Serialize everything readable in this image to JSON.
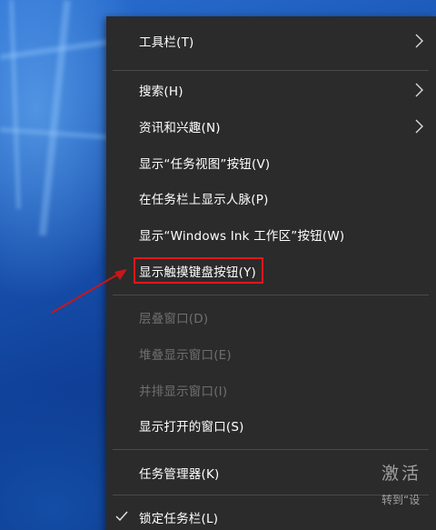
{
  "menu": {
    "items": [
      {
        "label": "工具栏(T)",
        "submenu": true
      },
      {
        "label": "搜索(H)",
        "submenu": true
      },
      {
        "label": "资讯和兴趣(N)",
        "submenu": true
      },
      {
        "label": "显示“任务视图”按钮(V)"
      },
      {
        "label": "在任务栏上显示人脉(P)"
      },
      {
        "label": "显示“Windows Ink 工作区”按钮(W)"
      },
      {
        "label": "显示触摸键盘按钮(Y)",
        "highlighted": true
      },
      {
        "label": "层叠窗口(D)",
        "disabled": true
      },
      {
        "label": "堆叠显示窗口(E)",
        "disabled": true
      },
      {
        "label": "并排显示窗口(I)",
        "disabled": true
      },
      {
        "label": "显示打开的窗口(S)"
      },
      {
        "label": "任务管理器(K)"
      },
      {
        "label": "锁定任务栏(L)",
        "checked": true
      }
    ]
  },
  "watermark": {
    "line1": "激活",
    "line2": "转到“设"
  },
  "colors": {
    "menu_bg": "#2b2b2b",
    "menu_text": "#ffffff",
    "disabled_text": "#6f6f6f",
    "highlight_box": "#e3161b",
    "annotation_arrow": "#c9161b"
  }
}
